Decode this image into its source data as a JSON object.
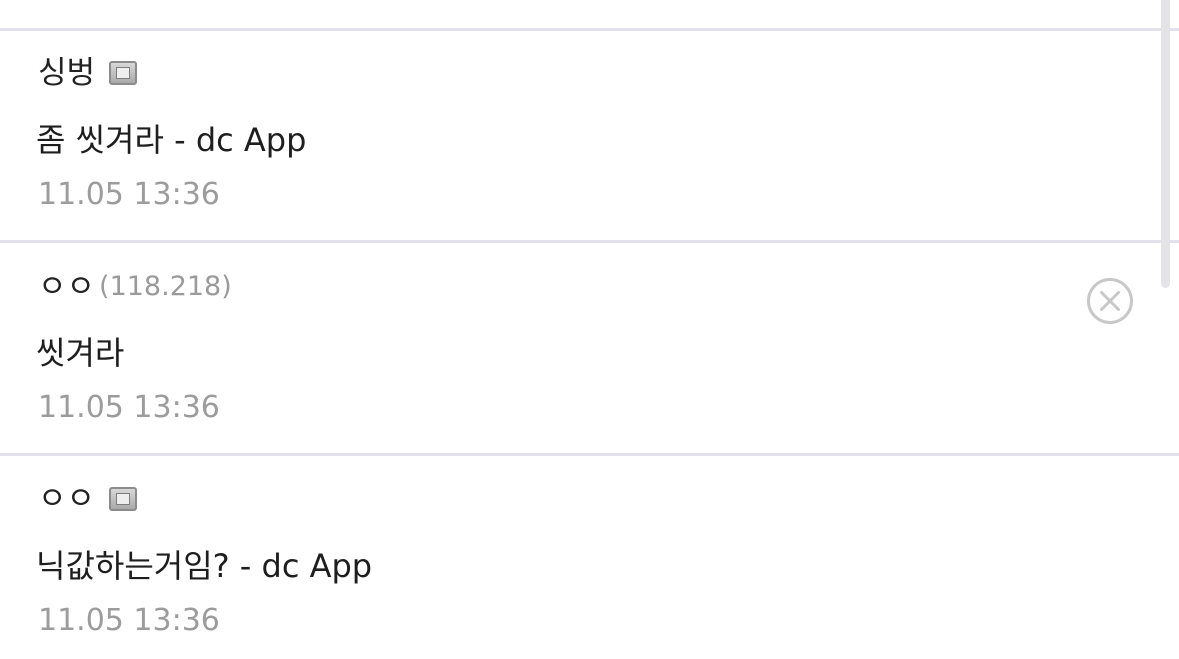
{
  "comments": [
    {
      "author": "싱벙",
      "author_ip": "",
      "has_badge": true,
      "text": "좀 씻겨라 - dc App",
      "timestamp": "11.05 13:36"
    },
    {
      "author": "ㅇㅇ",
      "author_ip": "(118.218)",
      "has_badge": false,
      "text": "씻겨라",
      "timestamp": "11.05 13:36",
      "has_delete_button": true
    },
    {
      "author": "ㅇㅇ",
      "author_ip": "",
      "has_badge": true,
      "text": "닉값하는거임? - dc App",
      "timestamp": "11.05 13:36"
    }
  ],
  "icons": {
    "badge": "fixed-nick-badge-icon",
    "delete": "delete-circle-x-icon"
  },
  "colors": {
    "divider": "#e2e1ec",
    "text": "#1e1e1e",
    "meta": "#9c9c9c",
    "delete_icon": "#c8c8c8"
  }
}
